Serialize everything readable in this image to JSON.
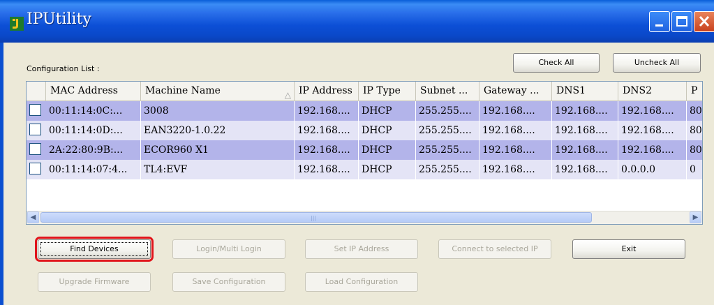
{
  "window": {
    "title": "IPUtility"
  },
  "config": {
    "label": "Configuration List :",
    "check_all": "Check All",
    "uncheck_all": "Uncheck All"
  },
  "columns": [
    "MAC Address",
    "Machine Name",
    "IP Address",
    "IP Type",
    "Subnet ...",
    "Gateway ...",
    "DNS1",
    "DNS2",
    "P"
  ],
  "rows": [
    {
      "mac": "00:11:14:0C:...",
      "name": "3008",
      "ip": "192.168....",
      "type": "DHCP",
      "subnet": "255.255....",
      "gateway": "192.168....",
      "dns1": "192.168....",
      "dns2": "192.168....",
      "port": "80",
      "state": "selected"
    },
    {
      "mac": "00:11:14:0D:...",
      "name": "EAN3220-1.0.22",
      "ip": "192.168....",
      "type": "DHCP",
      "subnet": "255.255....",
      "gateway": "192.168....",
      "dns1": "192.168....",
      "dns2": "192.168....",
      "port": "80",
      "state": "normal"
    },
    {
      "mac": "2A:22:80:9B:...",
      "name": "ECOR960 X1",
      "ip": "192.168....",
      "type": "DHCP",
      "subnet": "255.255....",
      "gateway": "192.168....",
      "dns1": "192.168....",
      "dns2": "192.168....",
      "port": "80",
      "state": "selected"
    },
    {
      "mac": "00:11:14:07:4...",
      "name": "TL4:EVF",
      "ip": "192.168....",
      "type": "DHCP",
      "subnet": "255.255....",
      "gateway": "192.168....",
      "dns1": "192.168....",
      "dns2": "0.0.0.0",
      "port": "0",
      "state": "normal"
    }
  ],
  "buttons": {
    "find_devices": "Find Devices",
    "login": "Login/Multi Login",
    "set_ip": "Set IP Address",
    "connect": "Connect to selected IP",
    "exit": "Exit",
    "upgrade": "Upgrade Firmware",
    "save_config": "Save Configuration",
    "load_config": "Load Configuration"
  },
  "icons": {
    "app": "app-logo-icon",
    "minimize": "minimize-icon",
    "maximize": "maximize-icon",
    "close": "close-icon",
    "sort": "sort-triangle-icon",
    "scroll_left": "scroll-left-icon",
    "scroll_right": "scroll-right-icon"
  },
  "colors": {
    "titlebar": "#0a48c8",
    "selected_row": "#b3b4ea",
    "normal_row": "#e4e4f6",
    "focus_highlight": "#e1141b"
  }
}
